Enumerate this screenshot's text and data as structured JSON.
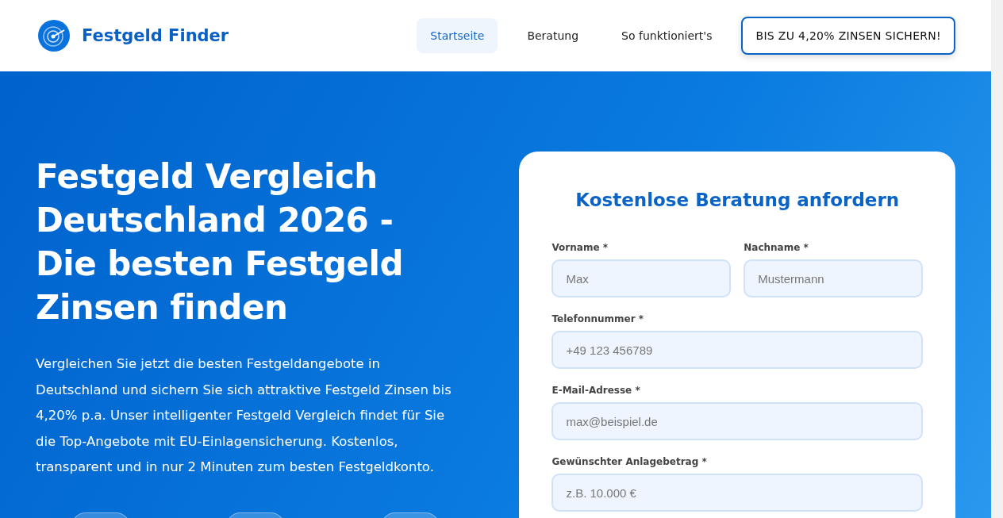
{
  "header": {
    "brand": "Festgeld Finder",
    "nav": [
      {
        "label": "Startseite",
        "selected": true
      },
      {
        "label": "Beratung",
        "selected": false
      },
      {
        "label": "So funktioniert's",
        "selected": false
      }
    ],
    "cta": "BIS ZU 4,20% ZINSEN SICHERN!"
  },
  "hero": {
    "title": "Festgeld Vergleich Deutschland 2026 - Die besten Festgeld Zinsen finden",
    "text": "Vergleichen Sie jetzt die besten Festgeldangebote in Deutschland und sichern Sie sich attraktive Festgeld Zinsen bis 4,20% p.a. Unser intelligenter Festgeld Vergleich findet für Sie die Top-Angebote mit EU-Einlagensicherung. Kostenlos, transparent und in nur 2 Minuten zum besten Festgeldkonto."
  },
  "form": {
    "title": "Kostenlose Beratung anfordern",
    "rows": [
      [
        {
          "label": "Vorname *",
          "placeholder": "Max"
        },
        {
          "label": "Nachname *",
          "placeholder": "Mustermann"
        }
      ],
      [
        {
          "label": "Telefonnummer *",
          "placeholder": "+49 123 456789"
        }
      ],
      [
        {
          "label": "E-Mail-Adresse *",
          "placeholder": "max@beispiel.de"
        }
      ],
      [
        {
          "label": "Gewünschter Anlagebetrag *",
          "placeholder": "z.B. 10.000 €"
        }
      ]
    ]
  }
}
